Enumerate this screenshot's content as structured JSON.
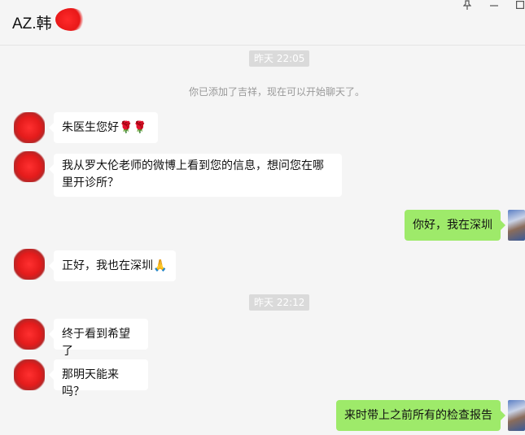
{
  "header": {
    "title": "AZ.韩",
    "pin_icon": "pin-icon",
    "minimize_icon": "minimize-icon",
    "maximize_icon": "maximize-icon"
  },
  "chat": {
    "time1": "昨天 22:05",
    "system_notice": "你已添加了吉祥，现在可以开始聊天了。",
    "messages": [
      {
        "side": "in",
        "text": "朱医生您好",
        "emoji": "🌹🌹"
      },
      {
        "side": "in",
        "text": "我从罗大伦老师的微博上看到您的信息，想问您在哪里开诊所？"
      },
      {
        "side": "out",
        "text": "你好，我在深圳"
      },
      {
        "side": "in",
        "text": "正好，我也在深圳",
        "emoji": "🙏"
      },
      {
        "side": "in",
        "text": "终于看到希望了"
      },
      {
        "side": "in",
        "text": "那明天能来吗？"
      },
      {
        "side": "out",
        "text": "来时带上之前所有的检查报告"
      }
    ],
    "time2": "昨天 22:12"
  }
}
